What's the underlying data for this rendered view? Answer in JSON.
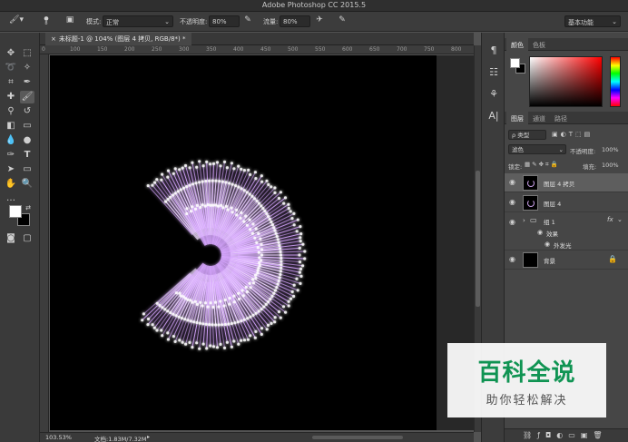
{
  "window": {
    "title": "Adobe Photoshop CC 2015.5"
  },
  "options_bar": {
    "mode_label": "模式:",
    "mode_value": "正常",
    "opacity_label": "不透明度:",
    "opacity_value": "80%",
    "flow_label": "流量:",
    "flow_value": "80%",
    "brush_size": "8",
    "workspace": "基本功能"
  },
  "document": {
    "tab_label": "未标题-1 @ 104% (图层 4 拷贝, RGB/8*) *",
    "ruler_ticks": [
      "0",
      "100",
      "150",
      "200",
      "250",
      "300",
      "350",
      "400",
      "450",
      "500",
      "550",
      "600",
      "650",
      "700",
      "750",
      "800"
    ],
    "zoom": "103.53%",
    "doc_size": "文档:1.83M/7.32M"
  },
  "color_panel": {
    "tabs": [
      "颜色",
      "色板"
    ]
  },
  "layers_panel": {
    "tabs": [
      "图层",
      "通道",
      "路径"
    ],
    "filter_kind": "ρ 类型",
    "blend_mode": "滤色",
    "opacity_label": "不透明度:",
    "opacity_value": "100%",
    "lock_label": "锁定:",
    "fill_label": "填充:",
    "fill_value": "100%",
    "layers": [
      {
        "name": "图层 4 拷贝",
        "selected": true
      },
      {
        "name": "图层 4",
        "selected": false
      },
      {
        "name": "组 1",
        "selected": false,
        "is_group": true,
        "fx": "fx"
      },
      {
        "name": "效果",
        "selected": false,
        "is_effect": true
      },
      {
        "name": "外发光",
        "selected": false,
        "is_effect": true
      },
      {
        "name": "背景",
        "selected": false,
        "locked": true
      }
    ]
  },
  "watermark": {
    "title": "百科全说",
    "subtitle": "助你轻松解决"
  },
  "colors": {
    "accent_purple": "#d7a6ff",
    "watermark_green": "#0c9a54"
  }
}
